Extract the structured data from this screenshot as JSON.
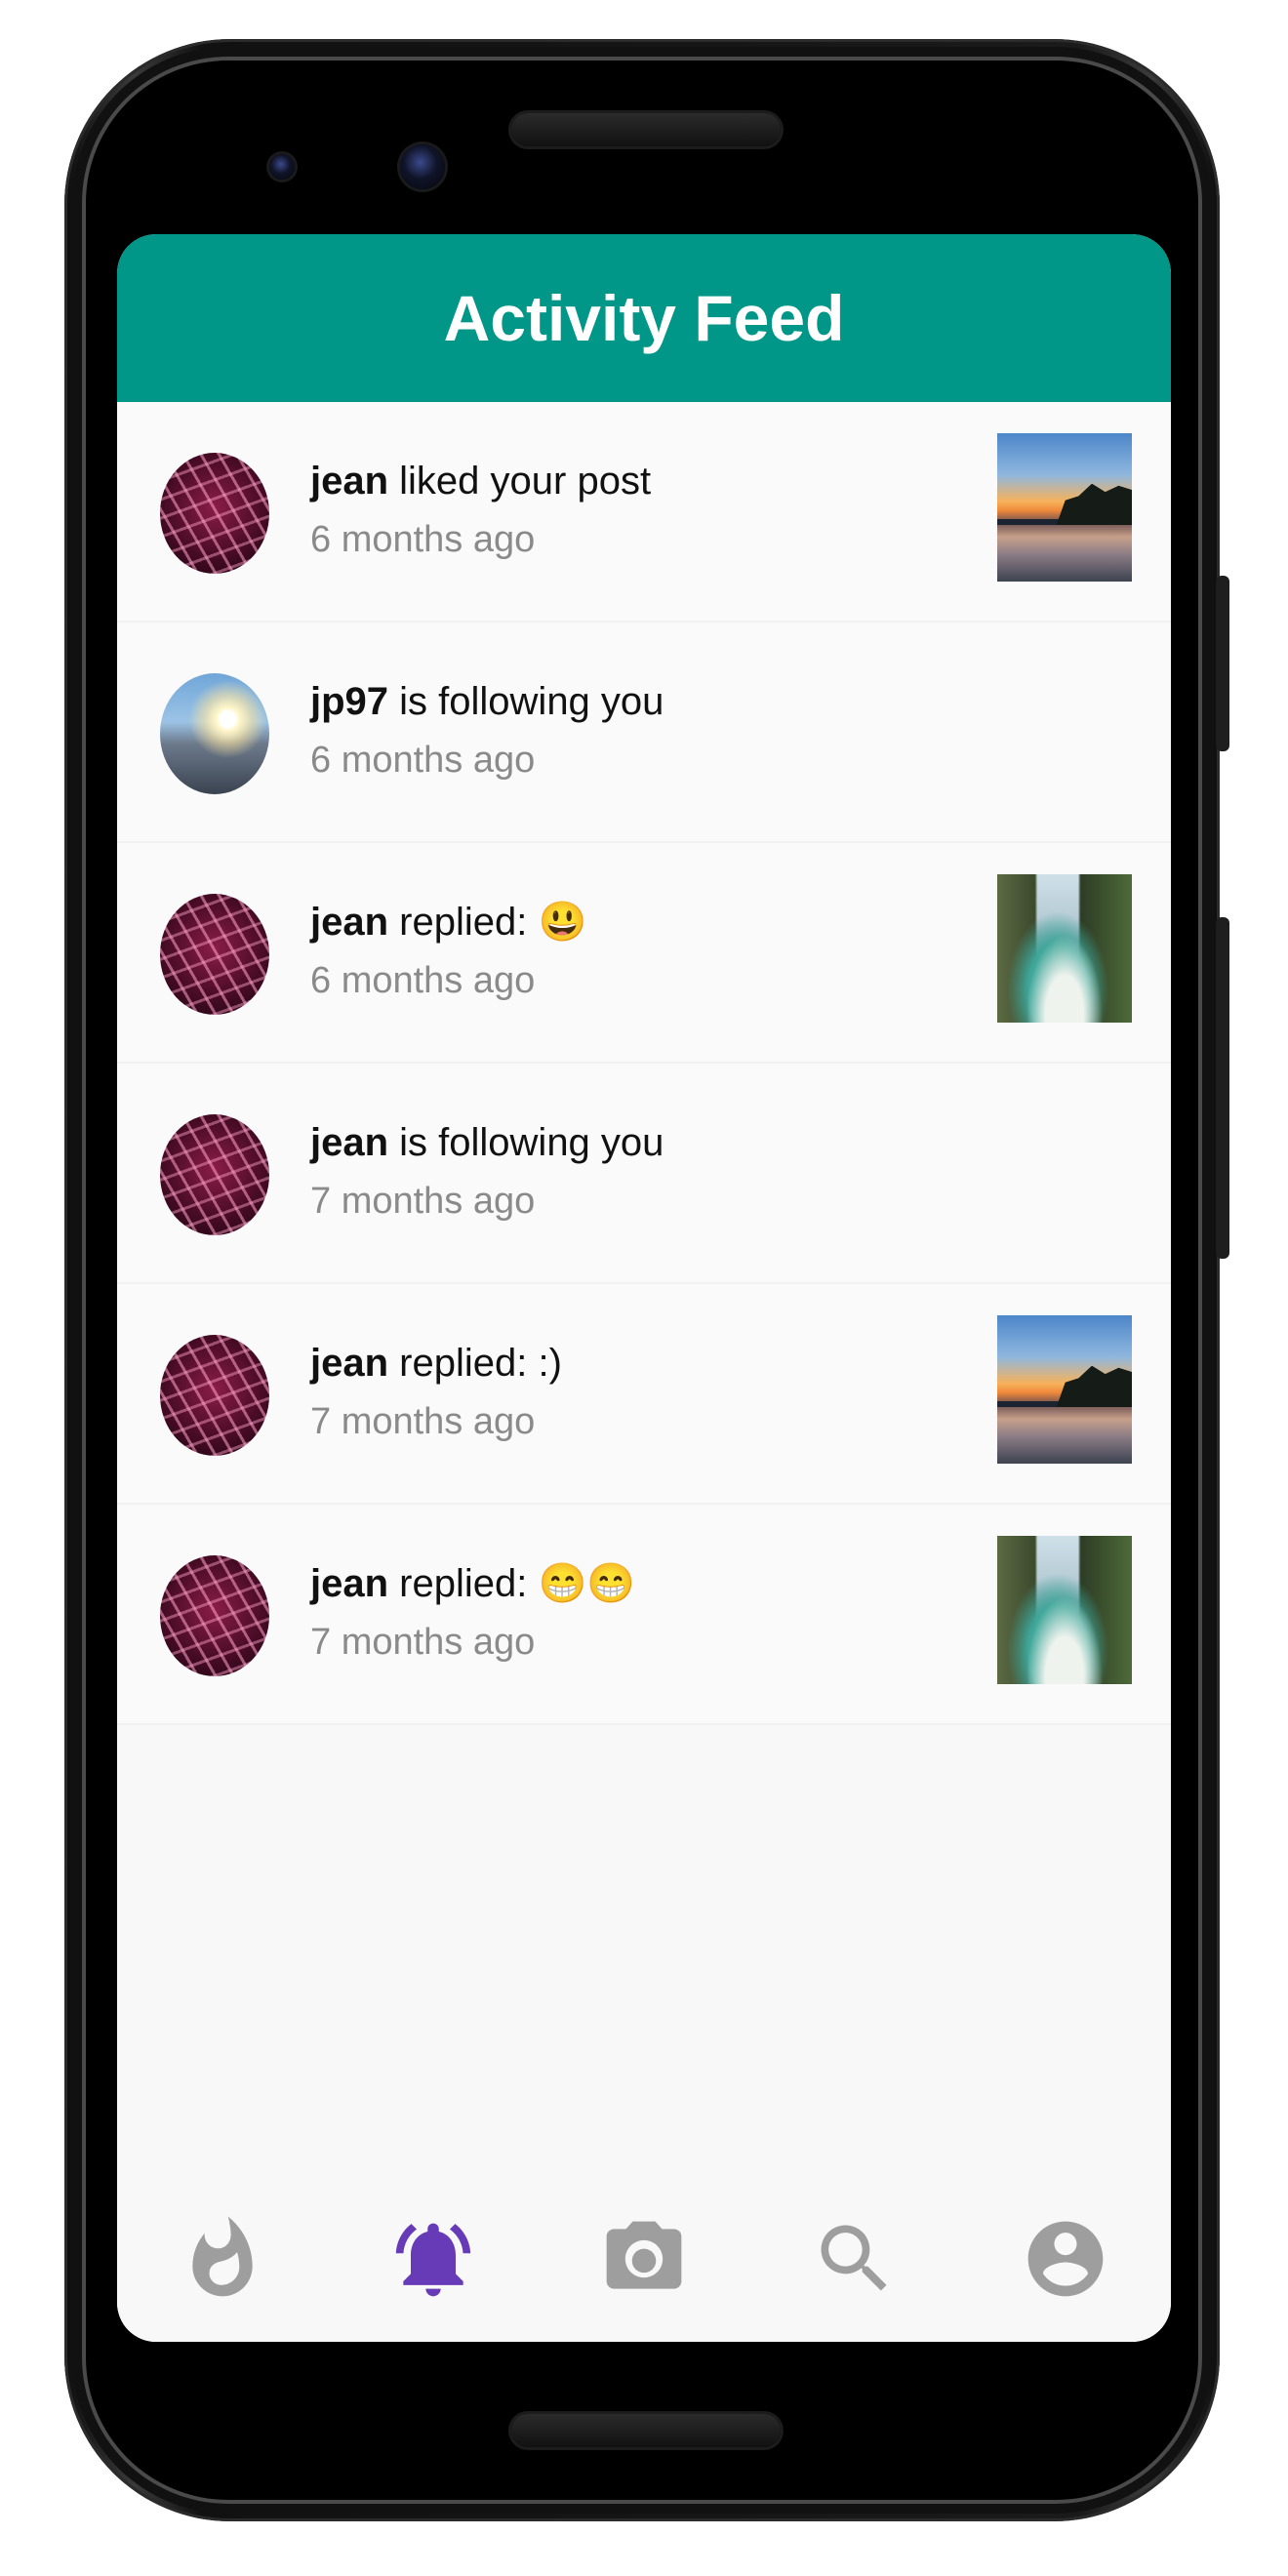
{
  "app": {
    "title": "Activity Feed",
    "accent_color": "#009688",
    "active_nav_color": "#673ab7",
    "inactive_nav_color": "#9e9e9e"
  },
  "feed": [
    {
      "username": "jean",
      "action": " liked your post",
      "time": "6 months ago",
      "avatar": "keyboard",
      "thumbnail": "beach-sunset"
    },
    {
      "username": "jp97",
      "action": " is following you",
      "time": "6 months ago",
      "avatar": "sunset-street",
      "thumbnail": null
    },
    {
      "username": "jean",
      "action": " replied: 😃",
      "time": "6 months ago",
      "avatar": "keyboard",
      "thumbnail": "cove"
    },
    {
      "username": "jean",
      "action": " is following you",
      "time": "7 months ago",
      "avatar": "keyboard",
      "thumbnail": null
    },
    {
      "username": "jean",
      "action": " replied: :)",
      "time": "7 months ago",
      "avatar": "keyboard",
      "thumbnail": "beach-sunset"
    },
    {
      "username": "jean",
      "action": " replied: 😁😁",
      "time": "7 months ago",
      "avatar": "keyboard",
      "thumbnail": "cove"
    }
  ],
  "bottom_nav": [
    {
      "icon": "whatshot-icon",
      "active": false
    },
    {
      "icon": "notifications-icon",
      "active": true
    },
    {
      "icon": "camera-icon",
      "active": false
    },
    {
      "icon": "search-icon",
      "active": false
    },
    {
      "icon": "account-circle-icon",
      "active": false
    }
  ]
}
